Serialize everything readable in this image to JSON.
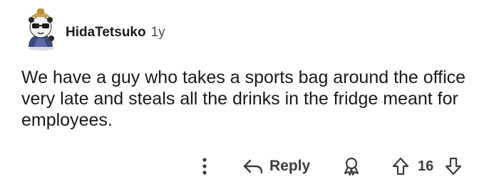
{
  "comment": {
    "author": "HidaTetsuko",
    "age": "1y",
    "text": "We have a guy who takes a sports bag around the office very late and steals all the drinks in the fridge meant for employees.",
    "score": "16"
  },
  "actions": {
    "reply_label": "Reply"
  },
  "icons": {
    "more": "more-vertical-icon",
    "reply": "reply-arrow-icon",
    "award": "award-icon",
    "upvote": "upvote-arrow-icon",
    "downvote": "downvote-arrow-icon"
  },
  "colors": {
    "text": "#1a1a1b",
    "muted": "#4a4a4c",
    "icon": "#3c3c3e",
    "background": "#ffffff"
  }
}
